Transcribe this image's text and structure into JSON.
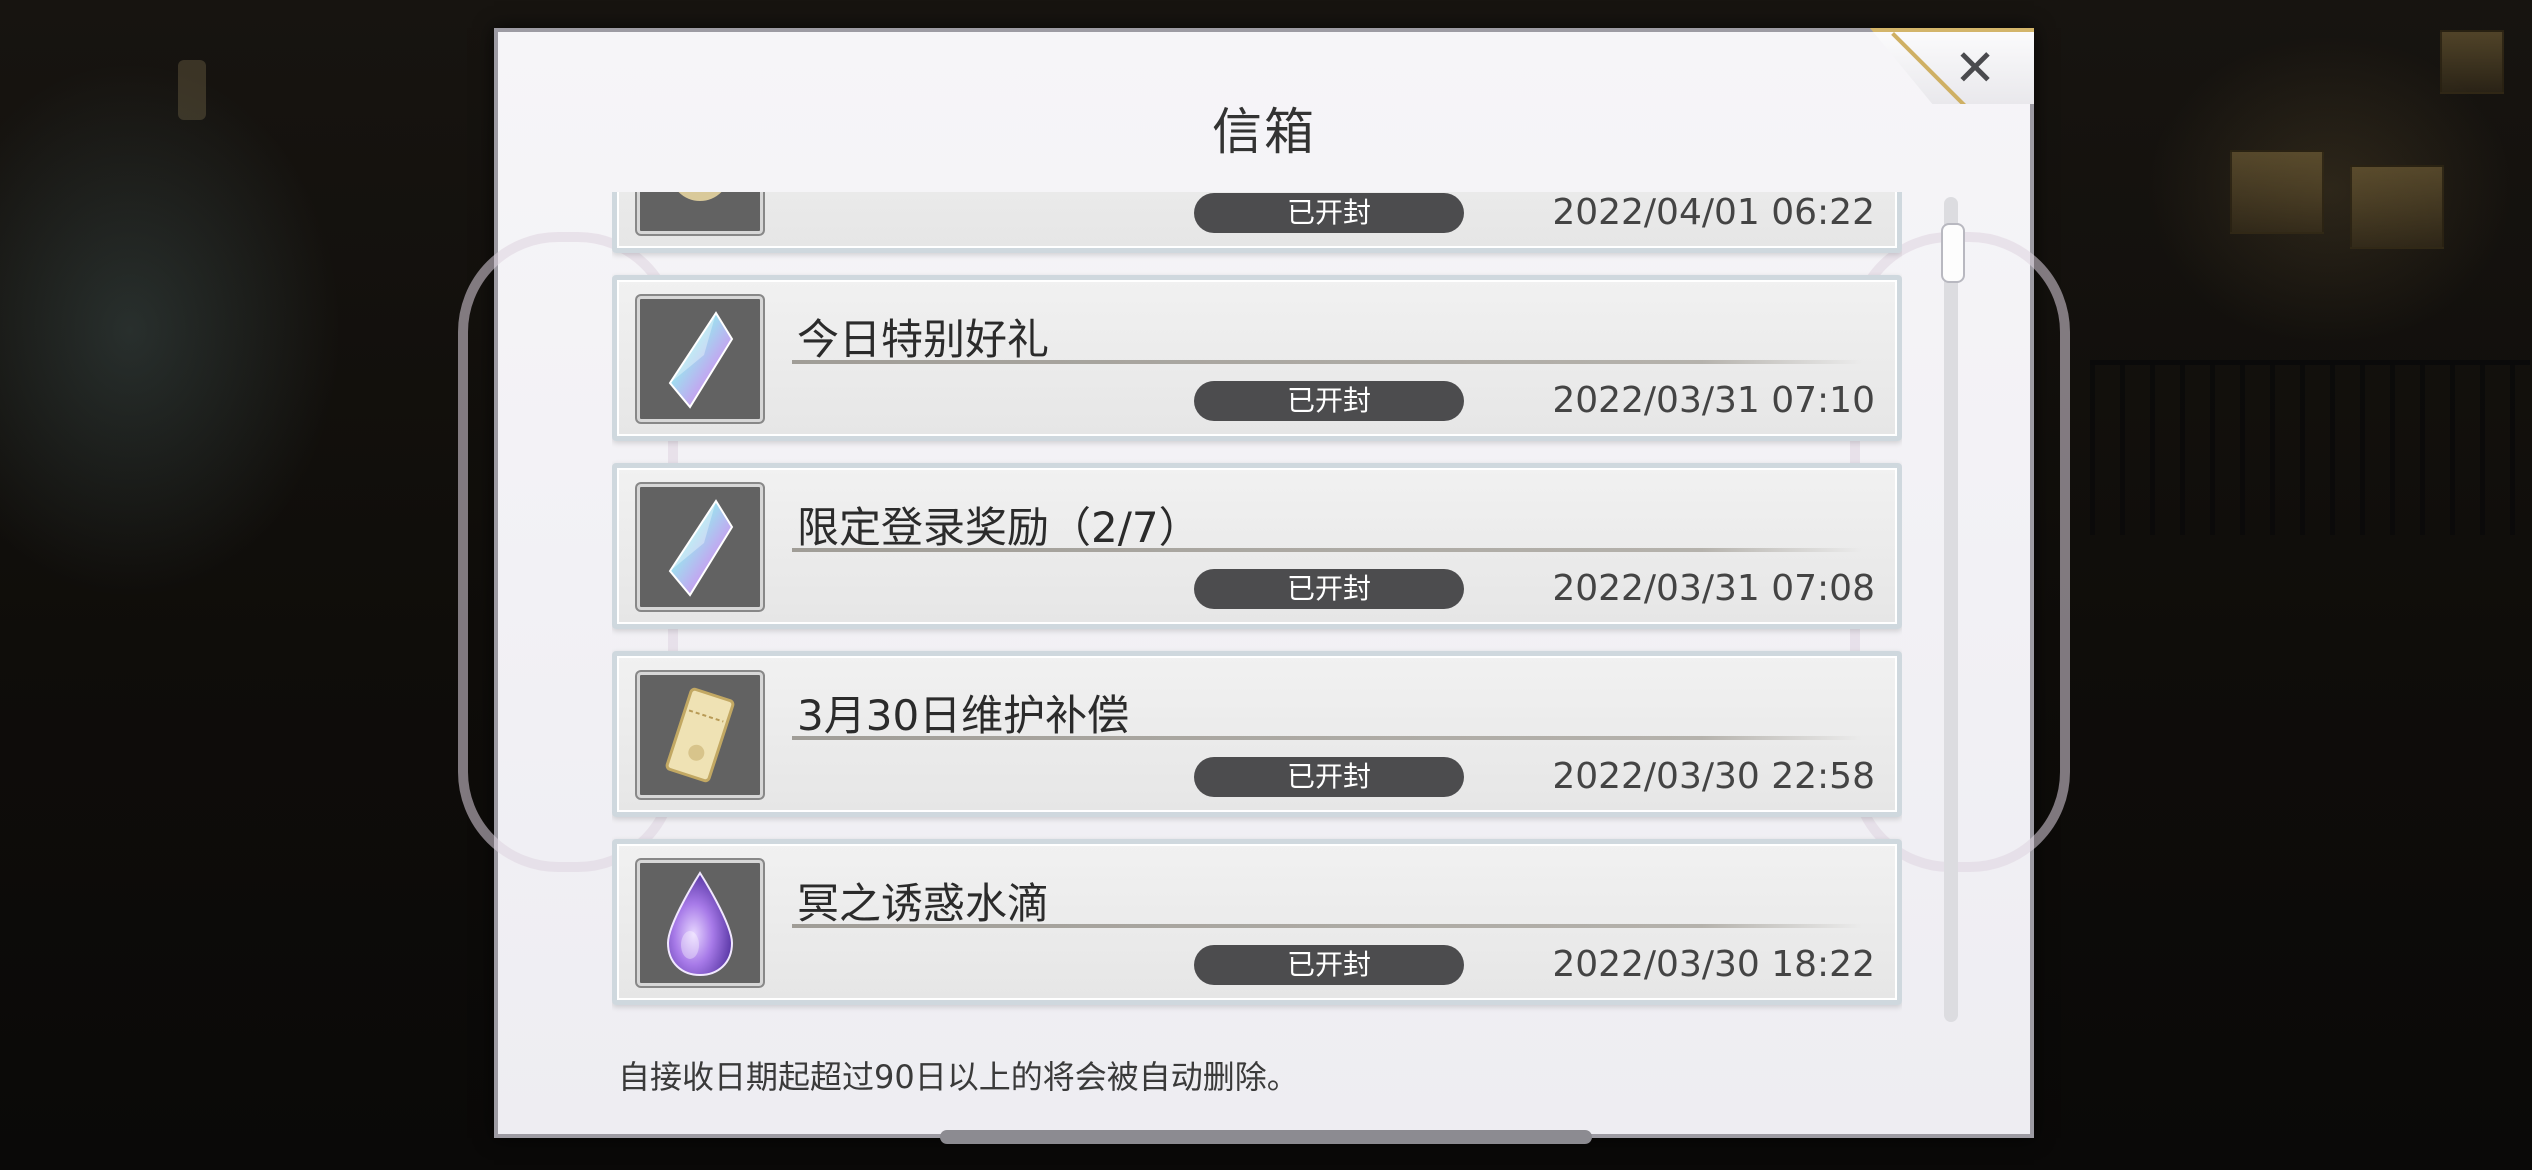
{
  "dialog": {
    "title": "信箱",
    "close_icon": "close-icon",
    "footer_note": "自接收日期起超过90日以上的将会被自动删除。"
  },
  "mails": [
    {
      "title": "",
      "status": "已开封",
      "date": "2022/04/01 06:22",
      "icon": "gift-icon"
    },
    {
      "title": "今日特别好礼",
      "status": "已开封",
      "date": "2022/03/31 07:10",
      "icon": "crystal-icon"
    },
    {
      "title": "限定登录奖励（2/7）",
      "status": "已开封",
      "date": "2022/03/31 07:08",
      "icon": "crystal-icon"
    },
    {
      "title": "3月30日维护补偿",
      "status": "已开封",
      "date": "2022/03/30 22:58",
      "icon": "ticket-icon"
    },
    {
      "title": "冥之诱惑水滴",
      "status": "已开封",
      "date": "2022/03/30 18:22",
      "icon": "water-drop-icon"
    }
  ],
  "colors": {
    "badge": "#4c4c4e",
    "item_border": "#cfd8de",
    "close_accent": "#cfb064"
  }
}
